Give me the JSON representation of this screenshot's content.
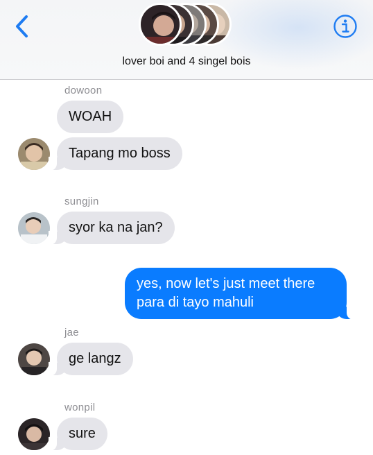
{
  "header": {
    "group_name": "lover boi and 4 singel bois",
    "back_icon": "chevron-left-icon",
    "info_icon": "info-icon",
    "accent": "#1e7cf2"
  },
  "messages": [
    {
      "sender": "dowoon",
      "text": "WOAH"
    },
    {
      "text": "Tapang mo boss"
    },
    {
      "sender": "sungjin",
      "text": "syor ka na jan?"
    },
    {
      "text": "yes, now let's just meet there para di tayo mahuli"
    },
    {
      "sender": "jae",
      "text": "ge langz"
    },
    {
      "sender": "wonpil",
      "text": "sure"
    }
  ],
  "colors": {
    "incoming_bubble": "#e5e5ea",
    "outgoing_bubble": "#0a7cff",
    "sender_label": "#8e8e93"
  }
}
